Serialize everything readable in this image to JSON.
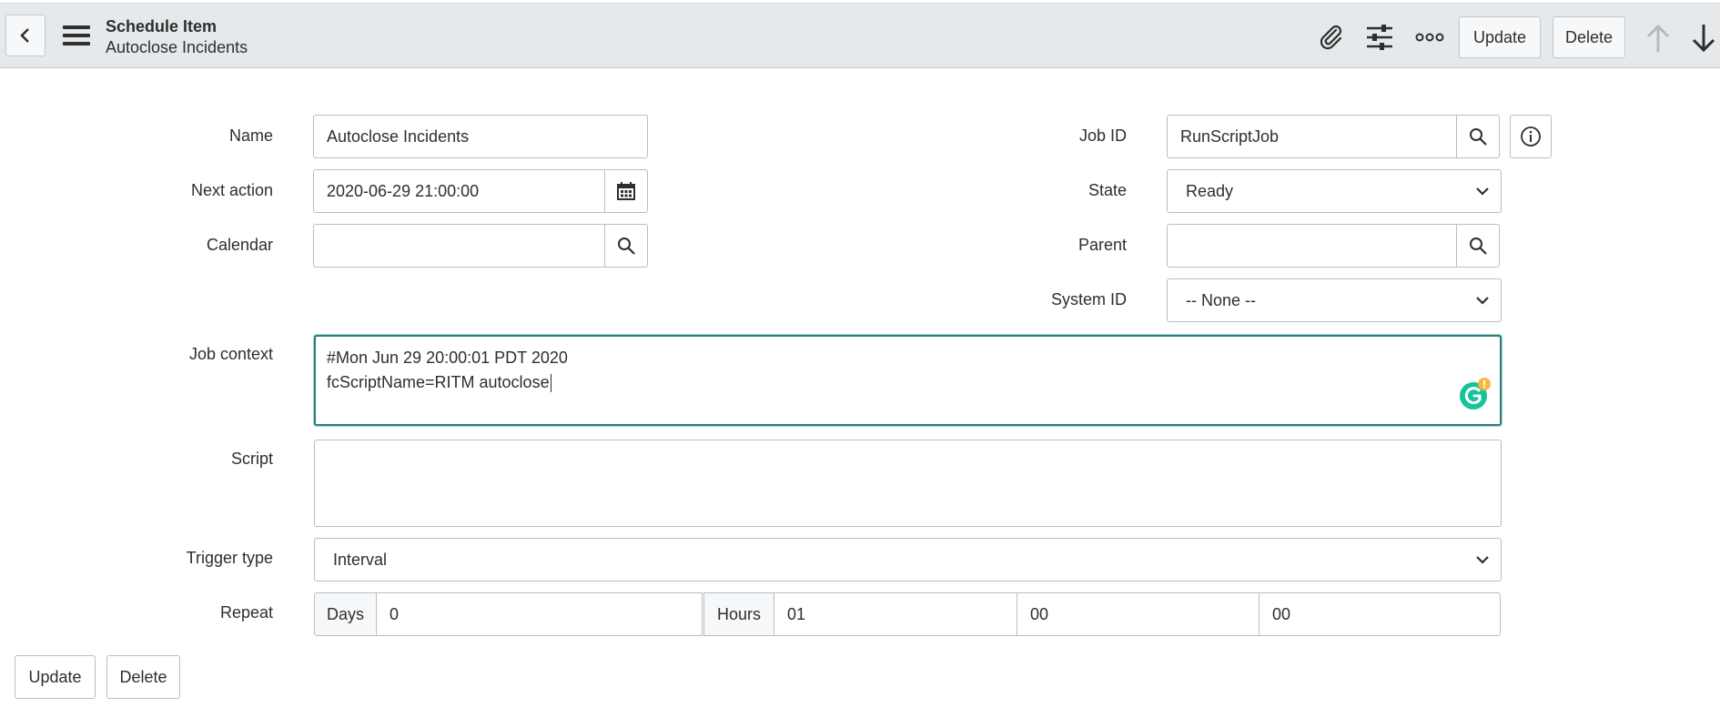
{
  "header": {
    "title": "Schedule Item",
    "subtitle": "Autoclose Incidents",
    "update_label": "Update",
    "delete_label": "Delete"
  },
  "form": {
    "name": {
      "label": "Name",
      "value": "Autoclose Incidents"
    },
    "next_action": {
      "label": "Next action",
      "value": "2020-06-29 21:00:00"
    },
    "calendar": {
      "label": "Calendar",
      "value": ""
    },
    "job_id": {
      "label": "Job ID",
      "value": "RunScriptJob"
    },
    "state": {
      "label": "State",
      "value": "Ready"
    },
    "parent": {
      "label": "Parent",
      "value": ""
    },
    "system_id": {
      "label": "System ID",
      "value": "-- None --"
    },
    "job_context": {
      "label": "Job context",
      "line1": "#Mon Jun 29 20:00:01 PDT 2020",
      "line2": "fcScriptName=RITM autoclose"
    },
    "script": {
      "label": "Script",
      "value": ""
    },
    "trigger_type": {
      "label": "Trigger type",
      "value": "Interval"
    },
    "repeat": {
      "label": "Repeat",
      "days_label": "Days",
      "days": "0",
      "hours_label": "Hours",
      "hours": "01",
      "minutes": "00",
      "seconds": "00"
    }
  },
  "footer": {
    "update_label": "Update",
    "delete_label": "Delete"
  },
  "colors": {
    "focus": "#27807a",
    "grammarly": "#15c39a",
    "warning": "#f5b83d",
    "header_bg": "#e6e9eb"
  },
  "icons": [
    "back-icon",
    "menu-icon",
    "attachment-icon",
    "settings-icon",
    "more-icon",
    "arrow-up-icon",
    "arrow-down-icon",
    "search-icon",
    "calendar-icon",
    "info-icon",
    "chevron-down-icon",
    "grammarly-icon"
  ]
}
